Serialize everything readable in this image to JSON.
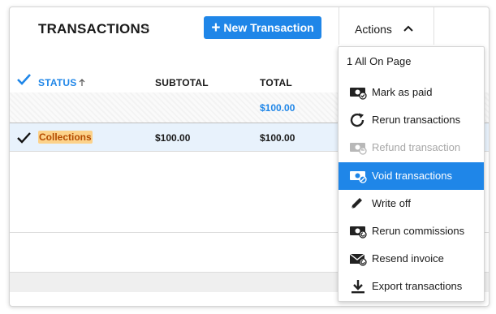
{
  "header": {
    "title": "TRANSACTIONS",
    "new_button": "New Transaction",
    "actions_label": "Actions"
  },
  "table": {
    "columns": [
      "STATUS",
      "SUBTOTAL",
      "TOTAL"
    ],
    "summary_total": "$100.00",
    "rows": [
      {
        "status": "Collections",
        "subtotal": "$100.00",
        "total": "$100.00"
      }
    ]
  },
  "menu": {
    "header": "1 All On Page",
    "items": [
      {
        "label": "Mark as paid",
        "icon": "cash-check-icon",
        "state": "normal"
      },
      {
        "label": "Rerun transactions",
        "icon": "refresh-icon",
        "state": "normal"
      },
      {
        "label": "Refund transaction",
        "icon": "cash-refund-icon",
        "state": "disabled"
      },
      {
        "label": "Void transactions",
        "icon": "cash-void-icon",
        "state": "highlighted"
      },
      {
        "label": "Write off",
        "icon": "pencil-icon",
        "state": "normal"
      },
      {
        "label": "Rerun commissions",
        "icon": "cash-refresh-icon",
        "state": "normal"
      },
      {
        "label": "Resend invoice",
        "icon": "envelope-resend-icon",
        "state": "normal"
      },
      {
        "label": "Export transactions",
        "icon": "download-icon",
        "state": "normal"
      }
    ]
  },
  "colors": {
    "accent": "#1f86e8",
    "badge_bg": "#fcd28a",
    "badge_text": "#b44b00",
    "selected_row": "#e8f2fc"
  }
}
